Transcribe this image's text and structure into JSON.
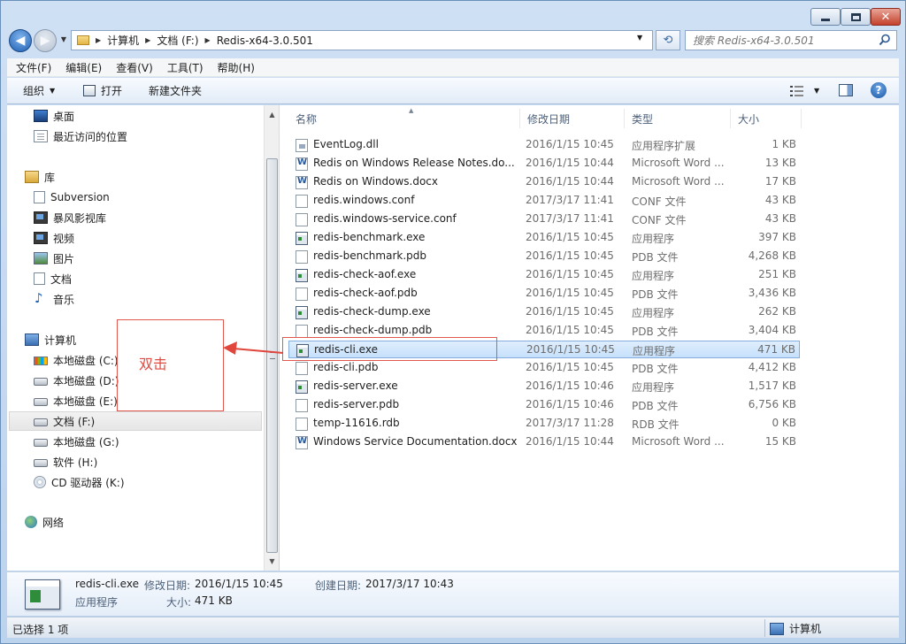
{
  "address": {
    "crumbs": [
      "计算机",
      "文档 (F:)",
      "Redis-x64-3.0.501"
    ]
  },
  "search": {
    "placeholder": "搜索 Redis-x64-3.0.501"
  },
  "menu": [
    "文件(F)",
    "编辑(E)",
    "查看(V)",
    "工具(T)",
    "帮助(H)"
  ],
  "toolbar": {
    "organize": "组织",
    "open": "打开",
    "new_folder": "新建文件夹"
  },
  "nav": {
    "desktop": "桌面",
    "recent": "最近访问的位置",
    "libraries": "库",
    "subversion": "Subversion",
    "baofeng": "暴风影视库",
    "videos": "视频",
    "pictures": "图片",
    "documents": "文档",
    "music": "音乐",
    "computer": "计算机",
    "drive_c": "本地磁盘 (C:)",
    "drive_d": "本地磁盘 (D:)",
    "drive_e": "本地磁盘 (E:)",
    "drive_f": "文档 (F:)",
    "drive_g": "本地磁盘 (G:)",
    "drive_h": "软件 (H:)",
    "drive_k": "CD 驱动器 (K:)",
    "network": "网络"
  },
  "columns": {
    "name": "名称",
    "date": "修改日期",
    "type": "类型",
    "size": "大小"
  },
  "files": [
    {
      "name": "EventLog.dll",
      "date": "2016/1/15 10:45",
      "type": "应用程序扩展",
      "size": "1 KB",
      "icon": "dll"
    },
    {
      "name": "Redis on Windows Release Notes.do...",
      "date": "2016/1/15 10:44",
      "type": "Microsoft Word ...",
      "size": "13 KB",
      "icon": "word"
    },
    {
      "name": "Redis on Windows.docx",
      "date": "2016/1/15 10:44",
      "type": "Microsoft Word ...",
      "size": "17 KB",
      "icon": "word"
    },
    {
      "name": "redis.windows.conf",
      "date": "2017/3/17 11:41",
      "type": "CONF 文件",
      "size": "43 KB",
      "icon": "file"
    },
    {
      "name": "redis.windows-service.conf",
      "date": "2017/3/17 11:41",
      "type": "CONF 文件",
      "size": "43 KB",
      "icon": "file"
    },
    {
      "name": "redis-benchmark.exe",
      "date": "2016/1/15 10:45",
      "type": "应用程序",
      "size": "397 KB",
      "icon": "exe"
    },
    {
      "name": "redis-benchmark.pdb",
      "date": "2016/1/15 10:45",
      "type": "PDB 文件",
      "size": "4,268 KB",
      "icon": "file"
    },
    {
      "name": "redis-check-aof.exe",
      "date": "2016/1/15 10:45",
      "type": "应用程序",
      "size": "251 KB",
      "icon": "exe"
    },
    {
      "name": "redis-check-aof.pdb",
      "date": "2016/1/15 10:45",
      "type": "PDB 文件",
      "size": "3,436 KB",
      "icon": "file"
    },
    {
      "name": "redis-check-dump.exe",
      "date": "2016/1/15 10:45",
      "type": "应用程序",
      "size": "262 KB",
      "icon": "exe"
    },
    {
      "name": "redis-check-dump.pdb",
      "date": "2016/1/15 10:45",
      "type": "PDB 文件",
      "size": "3,404 KB",
      "icon": "file"
    },
    {
      "name": "redis-cli.exe",
      "date": "2016/1/15 10:45",
      "type": "应用程序",
      "size": "471 KB",
      "icon": "exe"
    },
    {
      "name": "redis-cli.pdb",
      "date": "2016/1/15 10:45",
      "type": "PDB 文件",
      "size": "4,412 KB",
      "icon": "file"
    },
    {
      "name": "redis-server.exe",
      "date": "2016/1/15 10:46",
      "type": "应用程序",
      "size": "1,517 KB",
      "icon": "exe"
    },
    {
      "name": "redis-server.pdb",
      "date": "2016/1/15 10:46",
      "type": "PDB 文件",
      "size": "6,756 KB",
      "icon": "file"
    },
    {
      "name": "temp-11616.rdb",
      "date": "2017/3/17 11:28",
      "type": "RDB 文件",
      "size": "0 KB",
      "icon": "file"
    },
    {
      "name": "Windows Service Documentation.docx",
      "date": "2016/1/15 10:44",
      "type": "Microsoft Word ...",
      "size": "15 KB",
      "icon": "word"
    }
  ],
  "annotation": {
    "label": "双击"
  },
  "details": {
    "name": "redis-cli.exe",
    "modified_label": "修改日期:",
    "modified": "2016/1/15 10:45",
    "created_label": "创建日期:",
    "created": "2017/3/17 10:43",
    "type": "应用程序",
    "size_label": "大小:",
    "size": "471 KB"
  },
  "status": {
    "selected": "已选择 1 项",
    "location": "计算机"
  }
}
